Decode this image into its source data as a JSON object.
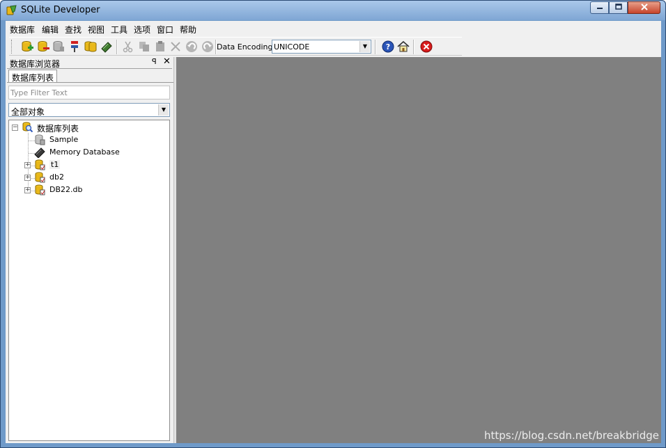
{
  "window": {
    "title": "SQLite Developer"
  },
  "menu": [
    "数据库",
    "编辑",
    "查找",
    "视图",
    "工具",
    "选项",
    "窗口",
    "帮助"
  ],
  "toolbar": {
    "encoding_label": "Data Encoding:",
    "encoding_value": "UNICODE",
    "buttons": [
      "add-database-icon",
      "remove-database-icon",
      "database-properties-icon",
      "refresh-icon",
      "attach-database-icon",
      "memory-database-icon",
      "cut-icon",
      "copy-icon",
      "paste-icon",
      "delete-icon",
      "undo-icon",
      "redo-icon",
      "help-icon",
      "home-icon",
      "close-red-icon"
    ]
  },
  "panel": {
    "title": "数据库浏览器",
    "tab": "数据库列表",
    "filter_placeholder": "Type Filter Text",
    "object_filter": "全部对象"
  },
  "tree": {
    "root": "数据库列表",
    "items": [
      "Sample",
      "Memory Database",
      "t1",
      "db2",
      "DB22.db"
    ]
  },
  "watermark": "https://blog.csdn.net/breakbridge",
  "colors": {
    "workspace": "#808080",
    "titlebar": "#8fb2dc",
    "close": "#c7442b"
  }
}
